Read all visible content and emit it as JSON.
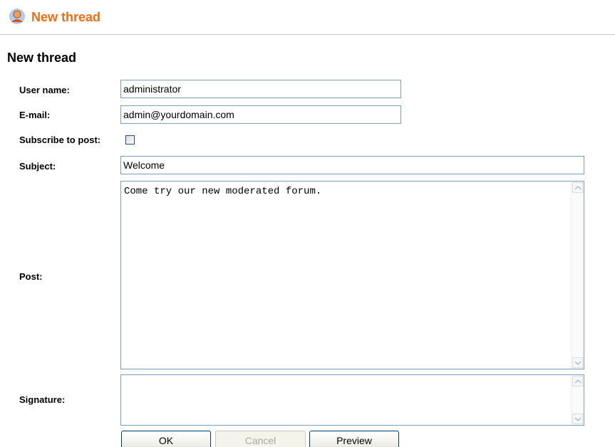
{
  "header": {
    "title": "New thread",
    "icon": "user-icon"
  },
  "form": {
    "section_title": "New thread",
    "user_name": {
      "label": "User name:",
      "value": "administrator"
    },
    "email": {
      "label": "E-mail:",
      "value": "admin@yourdomain.com"
    },
    "subscribe": {
      "label": "Subscribe to post:",
      "checked": false
    },
    "subject": {
      "label": "Subject:",
      "value": "Welcome"
    },
    "post": {
      "label": "Post:",
      "value": "Come try our new moderated forum."
    },
    "signature": {
      "label": "Signature:",
      "value": ""
    }
  },
  "buttons": {
    "ok": "OK",
    "cancel": "Cancel",
    "preview": "Preview"
  },
  "colors": {
    "title_accent": "#f26b10",
    "input_border": "#7f9db9",
    "button_border": "#003c74"
  }
}
